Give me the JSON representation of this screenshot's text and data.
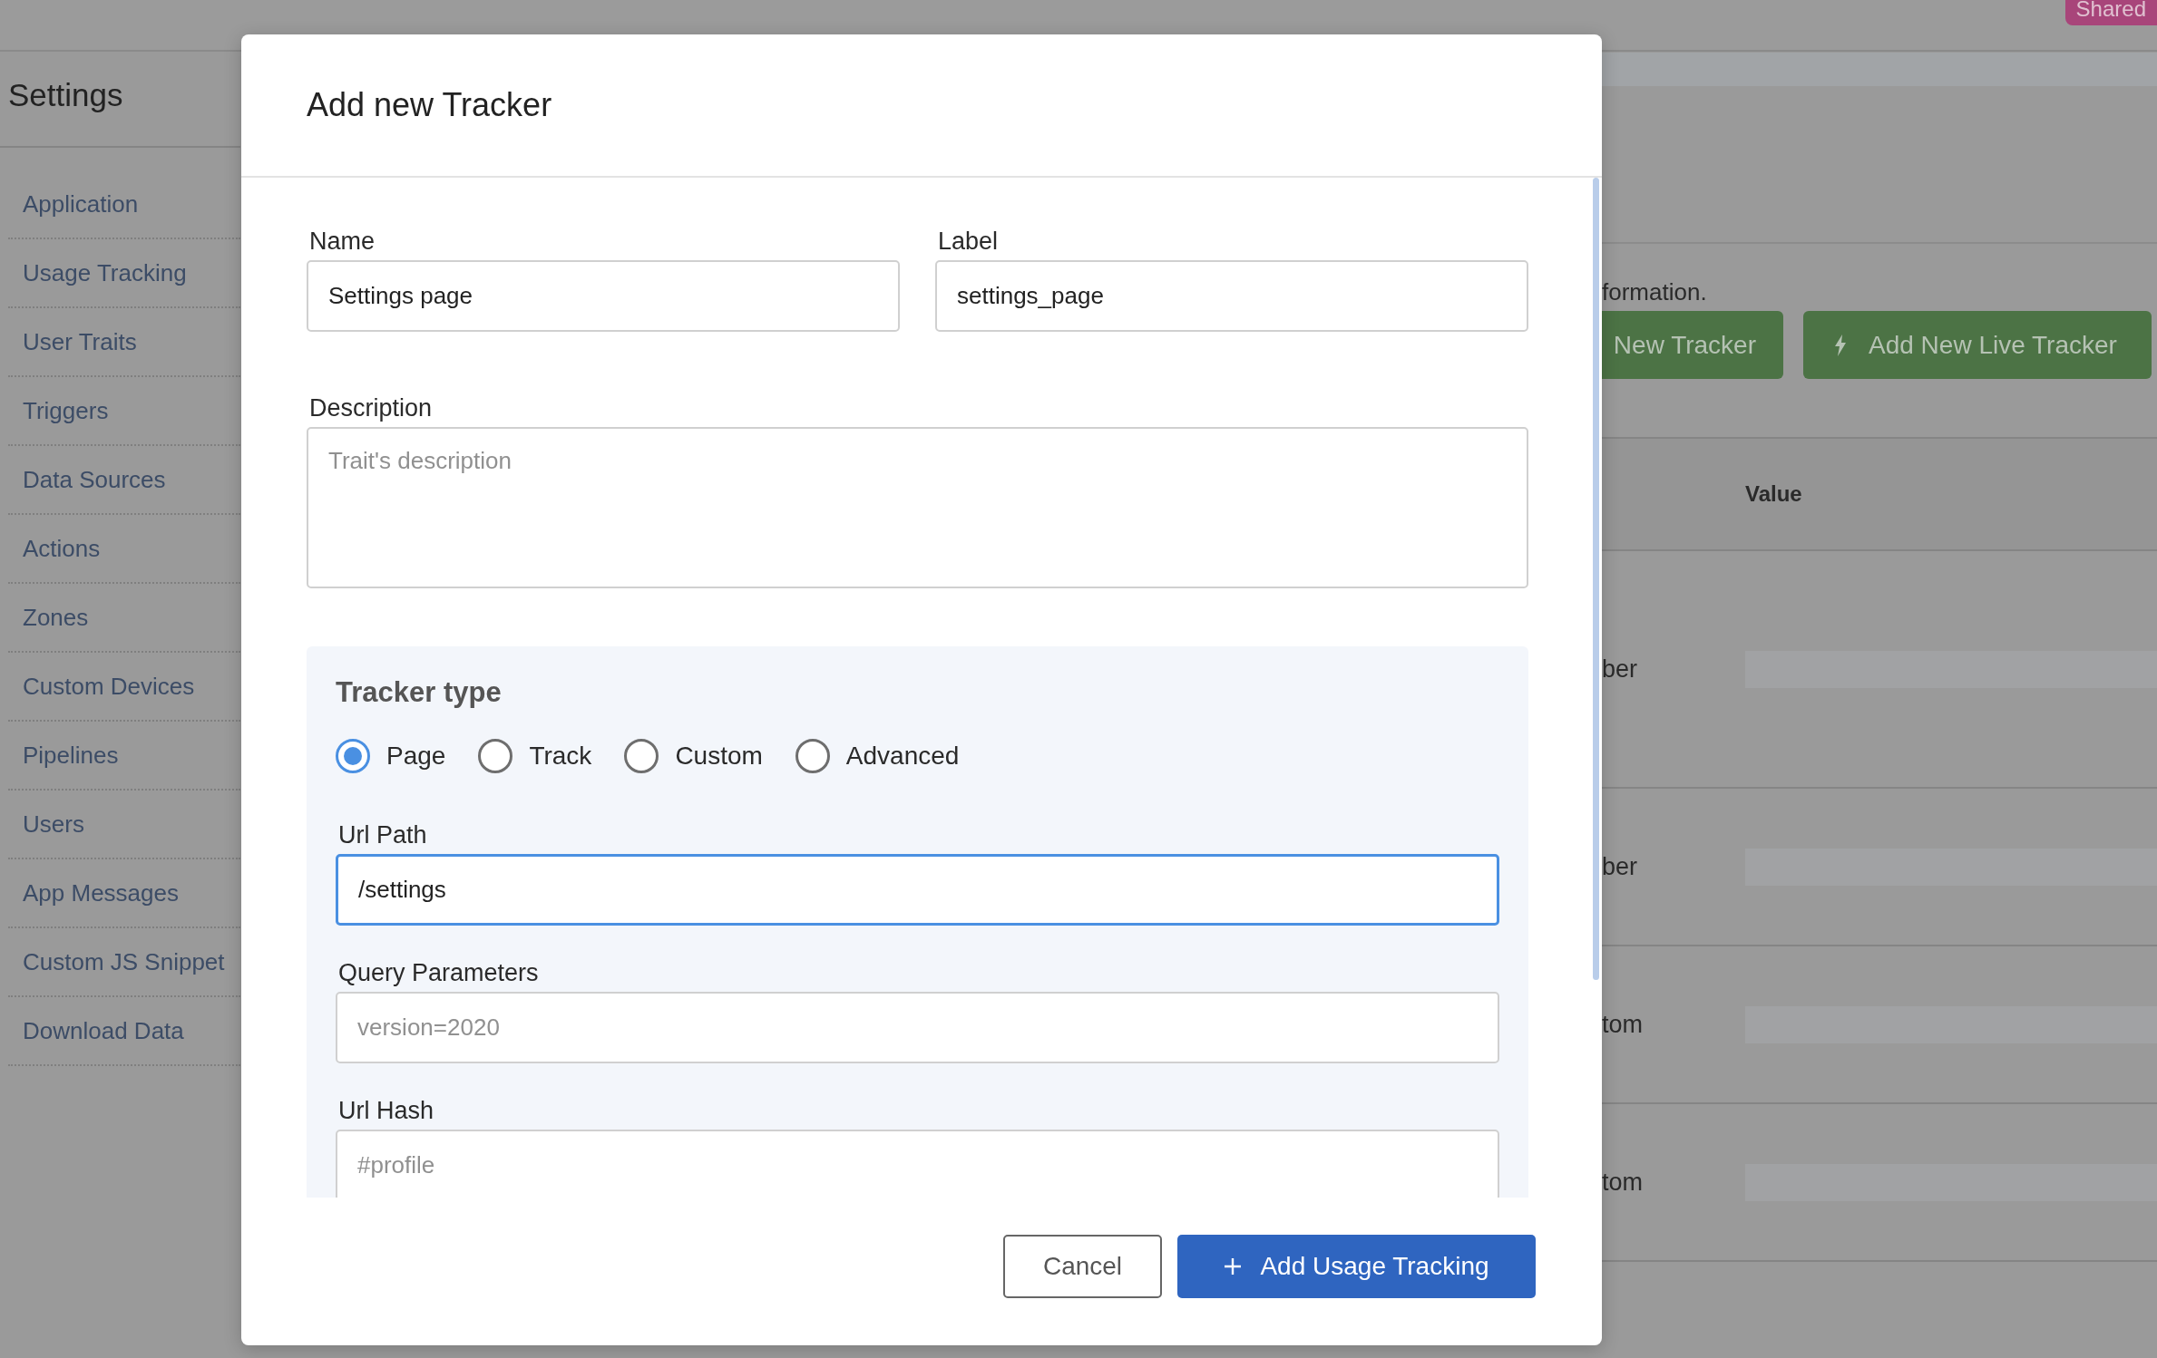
{
  "top_bar": {
    "badge": "Shared"
  },
  "sidebar": {
    "title": "Settings",
    "items": [
      {
        "label": "Application"
      },
      {
        "label": "Usage Tracking"
      },
      {
        "label": "User Traits"
      },
      {
        "label": "Triggers"
      },
      {
        "label": "Data Sources"
      },
      {
        "label": "Actions"
      },
      {
        "label": "Zones"
      },
      {
        "label": "Custom Devices"
      },
      {
        "label": "Pipelines"
      },
      {
        "label": "Users"
      },
      {
        "label": "App Messages"
      },
      {
        "label": "Custom JS Snippet"
      },
      {
        "label": "Download Data"
      }
    ]
  },
  "background": {
    "intro_text": "formation.",
    "buttons": [
      {
        "label": "New Tracker",
        "kind": "plain"
      },
      {
        "label": "Add New Live Tracker",
        "kind": "live"
      }
    ],
    "table": {
      "columns": [
        "Value"
      ],
      "rows": [
        {
          "column_1": "ber"
        },
        {
          "column_1": "ber"
        },
        {
          "column_1": "tom"
        },
        {
          "column_1": "tom"
        }
      ]
    }
  },
  "dialog": {
    "title": "Add new Tracker",
    "name": {
      "label": "Name",
      "value": "Settings page"
    },
    "label": {
      "label": "Label",
      "value": "settings_page"
    },
    "description": {
      "label": "Description",
      "placeholder": "Trait's description"
    },
    "tracker_type": {
      "title": "Tracker type",
      "options": [
        {
          "label": "Page",
          "selected": true
        },
        {
          "label": "Track",
          "selected": false
        },
        {
          "label": "Custom",
          "selected": false
        },
        {
          "label": "Advanced",
          "selected": false
        }
      ]
    },
    "url_path": {
      "label": "Url Path",
      "value": "/settings",
      "focused": true
    },
    "query_parameters": {
      "label": "Query Parameters",
      "placeholder": "version=2020"
    },
    "url_hash": {
      "label": "Url Hash",
      "placeholder": "#profile"
    },
    "buttons": [
      {
        "label": "Cancel",
        "kind": "secondary"
      },
      {
        "label": "Add Usage Tracking",
        "kind": "primary"
      }
    ]
  }
}
